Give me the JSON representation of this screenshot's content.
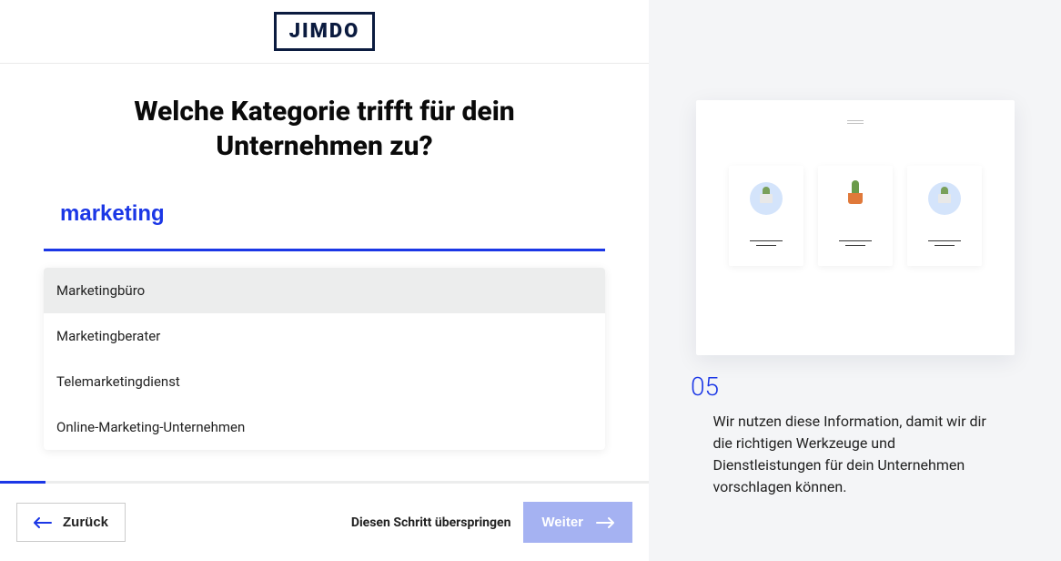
{
  "logo": "JIMDO",
  "title_line1": "Welche Kategorie trifft für dein",
  "title_line2": "Unternehmen zu?",
  "search_value": "marketing",
  "options": [
    "Marketingbüro",
    "Marketingberater",
    "Telemarketingdienst",
    "Online-Marketing-Unternehmen"
  ],
  "progress_percent": 7,
  "footer": {
    "back": "Zurück",
    "skip": "Diesen Schritt überspringen",
    "next": "Weiter"
  },
  "sidebar": {
    "step_number": "05",
    "description": "Wir nutzen diese Information, damit wir dir die richtigen Werkzeuge und Dienstleistungen für dein Unternehmen vorschlagen können."
  }
}
